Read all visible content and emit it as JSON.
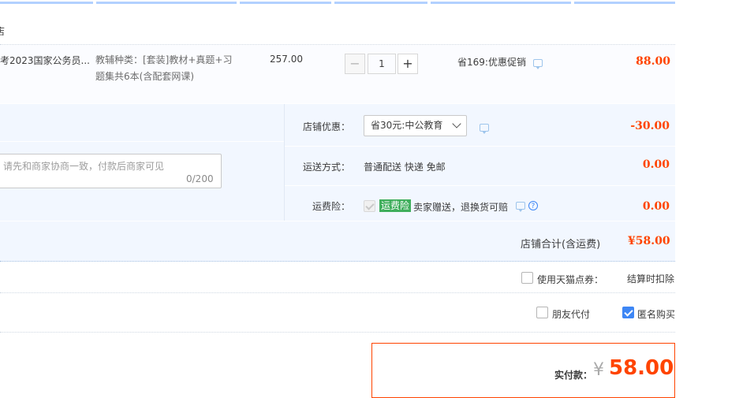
{
  "shop": {
    "name_fragment": "店"
  },
  "item": {
    "title": "考2023国家公务员...",
    "sku": "教辅种类：[套装]教材+真题+习题集共6本(含配套网课)",
    "price": "257.00",
    "quantity": "1",
    "promo": "省169:优惠促销",
    "subtotal": "88.00"
  },
  "message": {
    "placeholder": "请先和商家协商一致，付款后商家可见",
    "count": "0/200"
  },
  "options": {
    "coupon_label": "店铺优惠：",
    "coupon_value": "省30元:中公教育",
    "coupon_amount": "-30.00",
    "shipping_label": "运送方式：",
    "shipping_value": "普通配送 快递 免邮",
    "shipping_amount": "0.00",
    "insurance_label": "运费险：",
    "insurance_badge": "运费险",
    "insurance_text": "卖家赠送，退换货可赔",
    "insurance_amount": "0.00",
    "help_glyph": "?"
  },
  "shop_total": {
    "label": "店铺合计(含运费)",
    "value": "¥58.00"
  },
  "tmall_points": {
    "label": "使用天猫点券：",
    "note": "结算时扣除"
  },
  "friend_pay": {
    "label": "朋友代付"
  },
  "anonymous": {
    "label": "匿名购买"
  },
  "final": {
    "label": "实付款：",
    "currency": "¥",
    "amount": "58.00"
  },
  "icons": {
    "minus": "−",
    "plus": "+"
  },
  "colors": {
    "accent": "#ff4400",
    "blue": "#3d86f5",
    "badge_green": "#3fae5c"
  }
}
